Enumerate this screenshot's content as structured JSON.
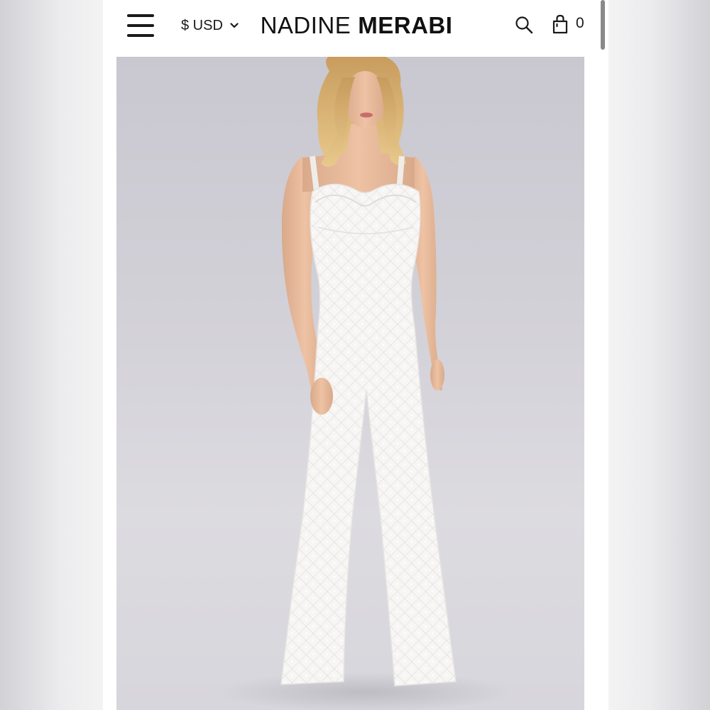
{
  "header": {
    "currency": "$ USD",
    "brand_light": "NADINE",
    "brand_bold": "MERABI",
    "cart_count": "0"
  },
  "icons": {
    "menu": "hamburger-menu-icon",
    "currency_toggle": "chevron-down-icon",
    "search": "search-icon",
    "cart": "shopping-bag-icon"
  },
  "product": {
    "image_alt": "Model wearing white sequin sweetheart-neck flared jumpsuit"
  },
  "colors": {
    "background": "#ffffff",
    "text": "#1a1a1a",
    "image_backdrop": "#d3d1d8"
  }
}
